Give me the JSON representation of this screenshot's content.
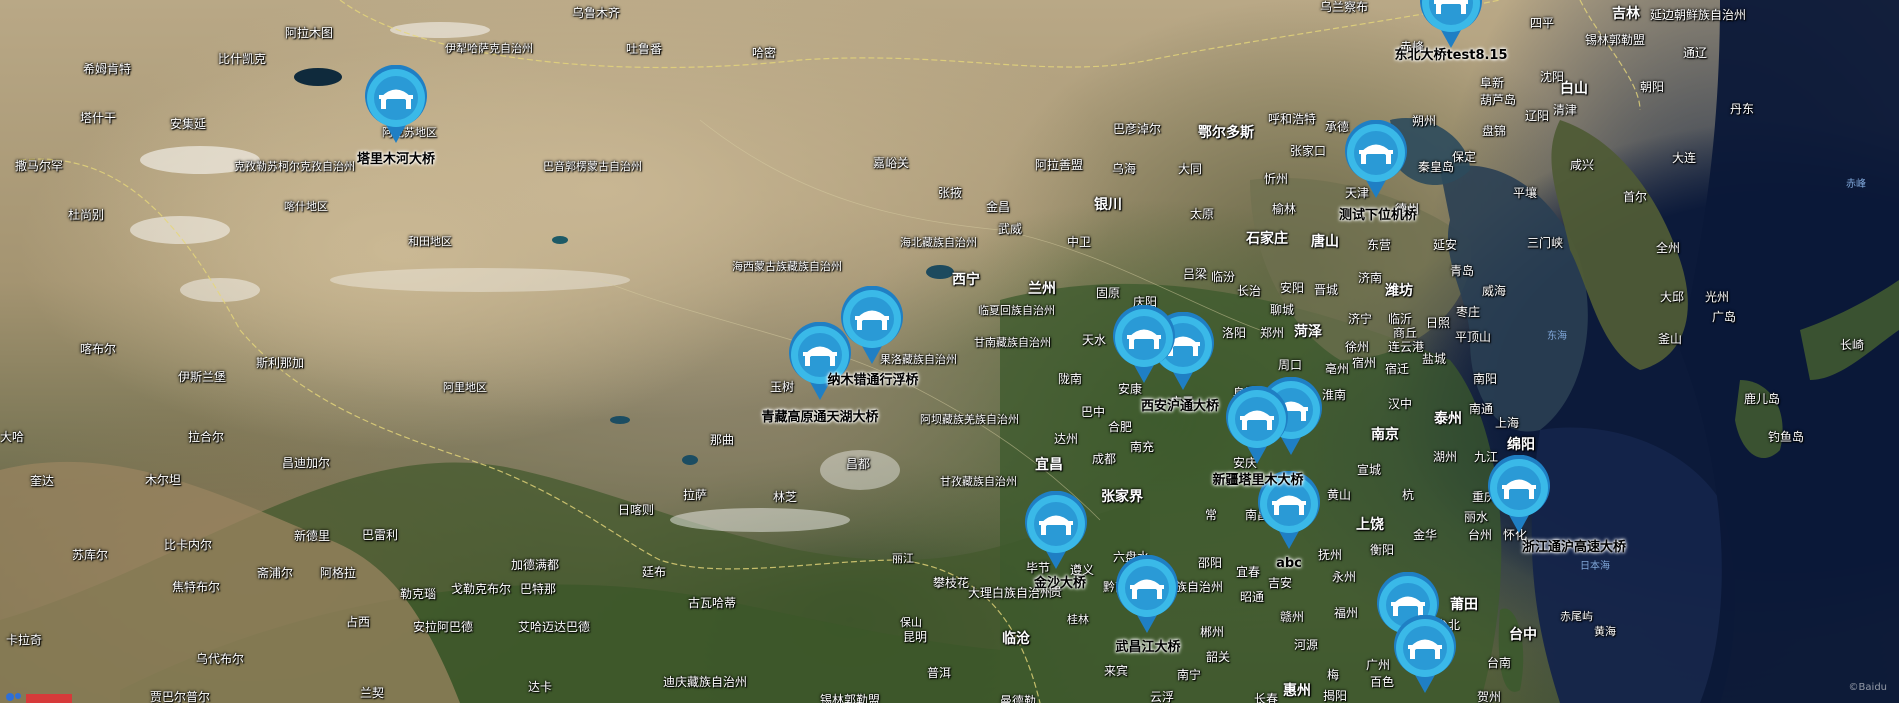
{
  "colors": {
    "marker_fill": "#34b7e6",
    "marker_dark": "#1f7fc4",
    "marker_icon": "#ffffff"
  },
  "places": [
    {
      "id": "p1",
      "text": "阿拉木图"
    },
    {
      "id": "p2",
      "text": "伊犁哈萨克自治州"
    },
    {
      "id": "p3",
      "text": "乌鲁木齐"
    },
    {
      "id": "p4",
      "text": "吐鲁番"
    },
    {
      "id": "p5",
      "text": "比什凯克"
    },
    {
      "id": "p6",
      "text": "希姆肯特"
    },
    {
      "id": "p7",
      "text": "塔什干"
    },
    {
      "id": "p8",
      "text": "安集延"
    },
    {
      "id": "p9",
      "text": "阿克苏地区"
    },
    {
      "id": "p10",
      "text": "克孜勒苏柯尔克孜自治州"
    },
    {
      "id": "p11",
      "text": "撒马尔罕"
    },
    {
      "id": "p12",
      "text": "杜尚别"
    },
    {
      "id": "p13",
      "text": "喀什地区"
    },
    {
      "id": "p14",
      "text": "和田地区"
    },
    {
      "id": "p15",
      "text": "巴音郭楞蒙古自治州"
    },
    {
      "id": "p16",
      "text": "哈密"
    },
    {
      "id": "p17",
      "text": "嘉峪关"
    },
    {
      "id": "p18",
      "text": "张掖"
    },
    {
      "id": "p19",
      "text": "金昌"
    },
    {
      "id": "p20",
      "text": "武威"
    },
    {
      "id": "p21",
      "text": "阿拉善盟"
    },
    {
      "id": "p22",
      "text": "巴彦淖尔"
    },
    {
      "id": "p23",
      "text": "乌海"
    },
    {
      "id": "p24",
      "text": "银川"
    },
    {
      "id": "p25",
      "text": "中卫"
    },
    {
      "id": "p26",
      "text": "海北藏族自治州"
    },
    {
      "id": "p27",
      "text": "海西蒙古族藏族自治州"
    },
    {
      "id": "p28",
      "text": "西宁"
    },
    {
      "id": "p29",
      "text": "兰州"
    },
    {
      "id": "p30",
      "text": "临夏回族自治州"
    },
    {
      "id": "p31",
      "text": "甘南藏族自治州"
    },
    {
      "id": "p32",
      "text": "固原"
    },
    {
      "id": "p33",
      "text": "庆阳"
    },
    {
      "id": "p34",
      "text": "天水"
    },
    {
      "id": "p35",
      "text": "宝鸡"
    },
    {
      "id": "p36",
      "text": "陇南"
    },
    {
      "id": "p37",
      "text": "喀布尔"
    },
    {
      "id": "p38",
      "text": "伊斯兰堡"
    },
    {
      "id": "p39",
      "text": "斯利那加"
    },
    {
      "id": "p40",
      "text": "阿里地区"
    },
    {
      "id": "p41",
      "text": "玉树"
    },
    {
      "id": "p42",
      "text": "果洛藏族自治州"
    },
    {
      "id": "p43",
      "text": "那曲"
    },
    {
      "id": "p44",
      "text": "阿坝藏族羌族自治州"
    },
    {
      "id": "p45",
      "text": "昌都"
    },
    {
      "id": "p46",
      "text": "甘孜藏族自治州"
    },
    {
      "id": "p47",
      "text": "拉萨"
    },
    {
      "id": "p48",
      "text": "林芝"
    },
    {
      "id": "p49",
      "text": "日喀则"
    },
    {
      "id": "p50",
      "text": "拉合尔"
    },
    {
      "id": "p51",
      "text": "昌迪加尔"
    },
    {
      "id": "p52",
      "text": "木尔坦"
    },
    {
      "id": "p53",
      "text": "奎达"
    },
    {
      "id": "p54",
      "text": "大哈"
    },
    {
      "id": "p55",
      "text": "新德里"
    },
    {
      "id": "p56",
      "text": "巴雷利"
    },
    {
      "id": "p57",
      "text": "加德满都"
    },
    {
      "id": "p58",
      "text": "苏库尔"
    },
    {
      "id": "p59",
      "text": "比卡内尔"
    },
    {
      "id": "p60",
      "text": "焦特布尔"
    },
    {
      "id": "p61",
      "text": "斋浦尔"
    },
    {
      "id": "p62",
      "text": "阿格拉"
    },
    {
      "id": "p63",
      "text": "勒克瑙"
    },
    {
      "id": "p64",
      "text": "戈勒克布尔"
    },
    {
      "id": "p65",
      "text": "巴特那"
    },
    {
      "id": "p66",
      "text": "廷布"
    },
    {
      "id": "p67",
      "text": "古瓦哈蒂"
    },
    {
      "id": "p68",
      "text": "卡拉奇"
    },
    {
      "id": "p69",
      "text": "乌代布尔"
    },
    {
      "id": "p70",
      "text": "占西"
    },
    {
      "id": "p71",
      "text": "安拉阿巴德"
    },
    {
      "id": "p72",
      "text": "艾哈迈达巴德"
    },
    {
      "id": "p73",
      "text": "贾巴尔普尔"
    },
    {
      "id": "p74",
      "text": "兰契"
    },
    {
      "id": "p75",
      "text": "达卡"
    },
    {
      "id": "p76",
      "text": "迪庆藏族自治州"
    },
    {
      "id": "p77",
      "text": "丽江"
    },
    {
      "id": "p78",
      "text": "攀枝花"
    },
    {
      "id": "p79",
      "text": "大理白族自治州"
    },
    {
      "id": "p80",
      "text": "保山"
    },
    {
      "id": "p81",
      "text": "昆明"
    },
    {
      "id": "p82",
      "text": "临沧"
    },
    {
      "id": "p83",
      "text": "普洱"
    },
    {
      "id": "p84",
      "text": "曼德勒"
    },
    {
      "id": "p85",
      "text": "锡林郭勒盟"
    },
    {
      "id": "p86",
      "text": "乌兰察布"
    },
    {
      "id": "p87",
      "text": "呼和浩特"
    },
    {
      "id": "p88",
      "text": "鄂尔多斯"
    },
    {
      "id": "p89",
      "text": "大同"
    },
    {
      "id": "p90",
      "text": "张家口"
    },
    {
      "id": "p91",
      "text": "承德"
    },
    {
      "id": "p92",
      "text": "朔州"
    },
    {
      "id": "p93",
      "text": "忻州"
    },
    {
      "id": "p94",
      "text": "榆林"
    },
    {
      "id": "p95",
      "text": "太原"
    },
    {
      "id": "p96",
      "text": "石家庄"
    },
    {
      "id": "p97",
      "text": "唐山"
    },
    {
      "id": "p98",
      "text": "秦皇岛"
    },
    {
      "id": "p99",
      "text": "保定"
    },
    {
      "id": "p100",
      "text": "天津"
    },
    {
      "id": "p101",
      "text": "德州"
    },
    {
      "id": "p102",
      "text": "东营"
    },
    {
      "id": "p103",
      "text": "延安"
    },
    {
      "id": "p104",
      "text": "吕梁"
    },
    {
      "id": "p105",
      "text": "临汾"
    },
    {
      "id": "p106",
      "text": "长治"
    },
    {
      "id": "p107",
      "text": "安阳"
    },
    {
      "id": "p108",
      "text": "晋城"
    },
    {
      "id": "p109",
      "text": "聊城"
    },
    {
      "id": "p110",
      "text": "济南"
    },
    {
      "id": "p111",
      "text": "潍坊"
    },
    {
      "id": "p112",
      "text": "青岛"
    },
    {
      "id": "p113",
      "text": "威海"
    },
    {
      "id": "p114",
      "text": "三门峡"
    },
    {
      "id": "p115",
      "text": "洛阳"
    },
    {
      "id": "p116",
      "text": "郑州"
    },
    {
      "id": "p117",
      "text": "菏泽"
    },
    {
      "id": "p118",
      "text": "济宁"
    },
    {
      "id": "p119",
      "text": "临沂"
    },
    {
      "id": "p120",
      "text": "日照"
    },
    {
      "id": "p121",
      "text": "枣庄"
    },
    {
      "id": "p122",
      "text": "商丘"
    },
    {
      "id": "p123",
      "text": "徐州"
    },
    {
      "id": "p124",
      "text": "连云港"
    },
    {
      "id": "p125",
      "text": "平顶山"
    },
    {
      "id": "p126",
      "text": "周口"
    },
    {
      "id": "p127",
      "text": "亳州"
    },
    {
      "id": "p128",
      "text": "宿州"
    },
    {
      "id": "p129",
      "text": "宿迁"
    },
    {
      "id": "p130",
      "text": "盐城"
    },
    {
      "id": "p131",
      "text": "南阳"
    },
    {
      "id": "p132",
      "text": "阜阳"
    },
    {
      "id": "p133",
      "text": "淮南"
    },
    {
      "id": "p134",
      "text": "汉中"
    },
    {
      "id": "p135",
      "text": "安康"
    },
    {
      "id": "p136",
      "text": "广元"
    },
    {
      "id": "p137",
      "text": "巴中"
    },
    {
      "id": "p138",
      "text": "合肥"
    },
    {
      "id": "p139",
      "text": "南京"
    },
    {
      "id": "p140",
      "text": "泰州"
    },
    {
      "id": "p141",
      "text": "南通"
    },
    {
      "id": "p142",
      "text": "上海"
    },
    {
      "id": "p143",
      "text": "绵阳"
    },
    {
      "id": "p144",
      "text": "达州"
    },
    {
      "id": "p145",
      "text": "南充"
    },
    {
      "id": "p146",
      "text": "成都"
    },
    {
      "id": "p147",
      "text": "宜昌"
    },
    {
      "id": "p148",
      "text": "安庆"
    },
    {
      "id": "p149",
      "text": "宣城"
    },
    {
      "id": "p150",
      "text": "湖州"
    },
    {
      "id": "p151",
      "text": "九江"
    },
    {
      "id": "p152",
      "text": "黄山"
    },
    {
      "id": "p153",
      "text": "杭"
    },
    {
      "id": "p154",
      "text": "重庆"
    },
    {
      "id": "p155",
      "text": "张家界"
    },
    {
      "id": "p156",
      "text": "常"
    },
    {
      "id": "p157",
      "text": "南昌"
    },
    {
      "id": "p158",
      "text": "上饶"
    },
    {
      "id": "p159",
      "text": "金华"
    },
    {
      "id": "p160",
      "text": "丽水"
    },
    {
      "id": "p161",
      "text": "台州"
    },
    {
      "id": "p162",
      "text": "怀化"
    },
    {
      "id": "p163",
      "text": "邵阳"
    },
    {
      "id": "p164",
      "text": "宜春"
    },
    {
      "id": "p165",
      "text": "抚州"
    },
    {
      "id": "p166",
      "text": "衡阳"
    },
    {
      "id": "p167",
      "text": "吉安"
    },
    {
      "id": "p168",
      "text": "永州"
    },
    {
      "id": "p169",
      "text": "昭通"
    },
    {
      "id": "p170",
      "text": "毕节"
    },
    {
      "id": "p171",
      "text": "遵义"
    },
    {
      "id": "p172",
      "text": "六盘水"
    },
    {
      "id": "p173",
      "text": "贵"
    },
    {
      "id": "p174",
      "text": "黔南布依族苗族自治州"
    },
    {
      "id": "p175",
      "text": "桂林"
    },
    {
      "id": "p176",
      "text": "郴州"
    },
    {
      "id": "p177",
      "text": "赣州"
    },
    {
      "id": "p178",
      "text": "福州"
    },
    {
      "id": "p179",
      "text": "莆田"
    },
    {
      "id": "p180",
      "text": "台北"
    },
    {
      "id": "p181",
      "text": "台中"
    },
    {
      "id": "p182",
      "text": "台南"
    },
    {
      "id": "p183",
      "text": "贺州"
    },
    {
      "id": "p184",
      "text": "韶关"
    },
    {
      "id": "p185",
      "text": "河源"
    },
    {
      "id": "p186",
      "text": "梅"
    },
    {
      "id": "p187",
      "text": "广州"
    },
    {
      "id": "p188",
      "text": "惠州"
    },
    {
      "id": "p189",
      "text": "揭阳"
    },
    {
      "id": "p190",
      "text": "百色"
    },
    {
      "id": "p191",
      "text": "来宾"
    },
    {
      "id": "p192",
      "text": "南宁"
    },
    {
      "id": "p193",
      "text": "云浮"
    },
    {
      "id": "p194",
      "text": "长春"
    },
    {
      "id": "p195",
      "text": "吉林"
    },
    {
      "id": "p196",
      "text": "延边朝鲜族自治州"
    },
    {
      "id": "p197",
      "text": "通辽"
    },
    {
      "id": "p198",
      "text": "四平"
    },
    {
      "id": "p199",
      "text": "锡林郭勒盟"
    },
    {
      "id": "p200",
      "text": "赤峰"
    },
    {
      "id": "p201",
      "text": "阜新"
    },
    {
      "id": "p202",
      "text": "沈阳"
    },
    {
      "id": "p203",
      "text": "白山"
    },
    {
      "id": "p204",
      "text": "朝阳"
    },
    {
      "id": "p205",
      "text": "葫芦岛"
    },
    {
      "id": "p206",
      "text": "盘锦"
    },
    {
      "id": "p207",
      "text": "辽阳"
    },
    {
      "id": "p208",
      "text": "清津"
    },
    {
      "id": "p209",
      "text": "丹东"
    },
    {
      "id": "p210",
      "text": "咸兴"
    },
    {
      "id": "p211",
      "text": "大连"
    },
    {
      "id": "p212",
      "text": "平壤"
    },
    {
      "id": "p213",
      "text": "首尔"
    },
    {
      "id": "p214",
      "text": "全州"
    },
    {
      "id": "p215",
      "text": "大邱"
    },
    {
      "id": "p216",
      "text": "光州"
    },
    {
      "id": "p217",
      "text": "釜山"
    },
    {
      "id": "p218",
      "text": "广岛"
    },
    {
      "id": "p219",
      "text": "长崎"
    },
    {
      "id": "p220",
      "text": "鹿儿岛"
    },
    {
      "id": "p221",
      "text": "钓鱼岛"
    },
    {
      "id": "p222",
      "text": "赤尾屿"
    },
    {
      "id": "p223",
      "text": "黄海"
    },
    {
      "id": "p224",
      "text": "东海"
    },
    {
      "id": "p225",
      "text": "日本海"
    },
    {
      "id": "p226",
      "text": "赤峰"
    }
  ],
  "bridges": [
    {
      "id": "b1",
      "name": "东北大桥test8.15"
    },
    {
      "id": "b2",
      "name": "塔里木河大桥"
    },
    {
      "id": "b3",
      "name": "测试下位机桥"
    },
    {
      "id": "b4",
      "name": "纳木错通行浮桥"
    },
    {
      "id": "b5",
      "name": "青藏高原通天湖大桥"
    },
    {
      "id": "b6",
      "name": "西安沪通大桥"
    },
    {
      "id": "b7",
      "name": ""
    },
    {
      "id": "b8",
      "name": "新疆塔里木大桥"
    },
    {
      "id": "b9",
      "name": ""
    },
    {
      "id": "b10",
      "name": "abc"
    },
    {
      "id": "b11",
      "name": "浙江通沪高速大桥"
    },
    {
      "id": "b12",
      "name": "金沙大桥"
    },
    {
      "id": "b13",
      "name": "武昌江大桥"
    },
    {
      "id": "b14",
      "name": ""
    },
    {
      "id": "b15",
      "name": ""
    }
  ],
  "footer": {
    "logo_text": "Baidu",
    "copyright": "©Baidu"
  }
}
